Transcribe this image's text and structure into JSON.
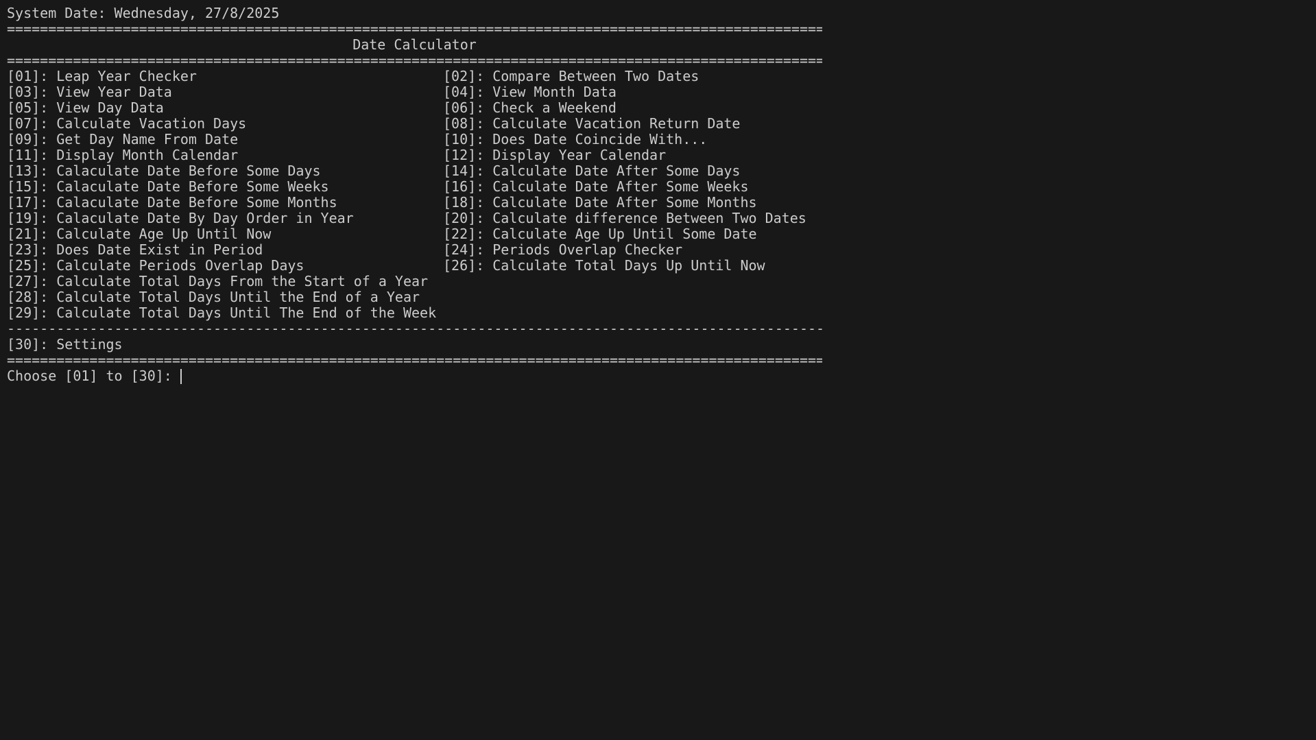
{
  "system_date": "System Date: Wednesday, 27/8/2025",
  "double_rule": "==============================================================================================================",
  "single_rule": "--------------------------------------------------------------------------------------------------------------",
  "title": "Date Calculator",
  "menu_rows": [
    {
      "left": "[01]: Leap Year Checker",
      "right": "[02]: Compare Between Two Dates"
    },
    {
      "left": "[03]: View Year Data",
      "right": "[04]: View Month Data"
    },
    {
      "left": "[05]: View Day Data",
      "right": "[06]: Check a Weekend"
    },
    {
      "left": "[07]: Calculate Vacation Days",
      "right": "[08]: Calculate Vacation Return Date"
    },
    {
      "left": "[09]: Get Day Name From Date",
      "right": "[10]: Does Date Coincide With..."
    },
    {
      "left": "[11]: Display Month Calendar",
      "right": "[12]: Display Year Calendar"
    },
    {
      "left": "[13]: Calaculate Date Before Some Days",
      "right": "[14]: Calculate Date After Some Days"
    },
    {
      "left": "[15]: Calaculate Date Before Some Weeks",
      "right": "[16]: Calculate Date After Some Weeks"
    },
    {
      "left": "[17]: Calaculate Date Before Some Months",
      "right": "[18]: Calculate Date After Some Months"
    },
    {
      "left": "[19]: Calaculate Date By Day Order in Year",
      "right": "[20]: Calculate difference Between Two Dates"
    },
    {
      "left": "[21]: Calculate Age Up Until Now",
      "right": "[22]: Calculate Age Up Until Some Date"
    },
    {
      "left": "[23]: Does Date Exist in Period",
      "right": "[24]: Periods Overlap Checker"
    },
    {
      "left": "[25]: Calculate Periods Overlap Days",
      "right": "[26]: Calculate Total Days Up Until Now"
    },
    {
      "left": "[27]: Calculate Total Days From the Start of a Year",
      "right": ""
    },
    {
      "left": "[28]: Calculate Total Days Until the End of a Year",
      "right": ""
    },
    {
      "left": "[29]: Calculate Total Days Until The End of the Week",
      "right": ""
    }
  ],
  "settings_item": "[30]: Settings",
  "prompt": "Choose [01] to [30]:",
  "colors": {
    "background": "#181818",
    "text": "#cccccc"
  }
}
